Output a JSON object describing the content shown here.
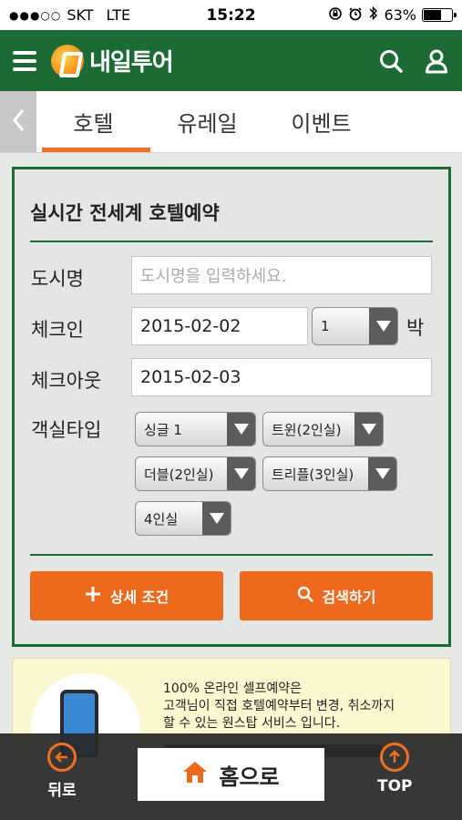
{
  "status": {
    "carrier": "SKT",
    "network": "LTE",
    "time": "15:22",
    "battery": "63%",
    "battery_level": 0.63
  },
  "header": {
    "logo_text": "내일투어"
  },
  "tabs": [
    {
      "label": "호텔",
      "active": true
    },
    {
      "label": "유레일",
      "active": false
    },
    {
      "label": "이벤트",
      "active": false
    }
  ],
  "search": {
    "title": "실시간 전세계 호텔예약",
    "city_label": "도시명",
    "city_placeholder": "도시명을 입력하세요.",
    "checkin_label": "체크인",
    "checkin_value": "2015-02-02",
    "nights_value": "1",
    "nights_unit": "박",
    "checkout_label": "체크아웃",
    "checkout_value": "2015-02-03",
    "roomtype_label": "객실타입",
    "rooms": {
      "single": "싱글 1",
      "twin": "트윈(2인실)",
      "double": "더블(2인실)",
      "triple": "트리플(3인실)",
      "quad": "4인실"
    },
    "detail_button": "상세 조건",
    "search_button": "검색하기"
  },
  "promo": {
    "line1": "100% 온라인 셀프예약은",
    "line2": "고객님이 직접 호텔예약부터 변경, 취소까지",
    "line3": "할 수 있는 원스탑 서비스 입니다."
  },
  "bottom": {
    "back_label": "뒤로",
    "home_label": "홈으로",
    "top_label": "TOP"
  },
  "colors": {
    "brand_green": "#1c6b34",
    "accent_orange": "#ed6a1c"
  }
}
